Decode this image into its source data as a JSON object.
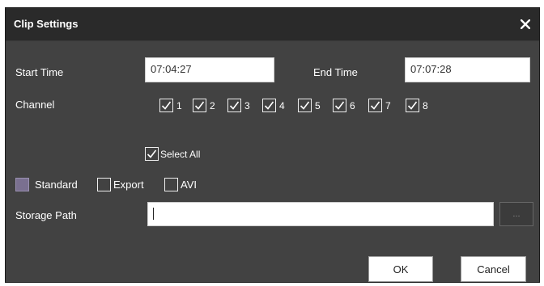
{
  "dialog": {
    "title": "Clip Settings",
    "close_glyph": "✕"
  },
  "time": {
    "start_label": "Start Time",
    "start_value": "07:04:27",
    "end_label": "End Time",
    "end_value": "07:07:28"
  },
  "channel": {
    "label": "Channel",
    "items": [
      "1",
      "2",
      "3",
      "4",
      "5",
      "6",
      "7",
      "8"
    ],
    "select_all_label": "Select All"
  },
  "format": {
    "options": [
      {
        "label": "Standard",
        "selected": true
      },
      {
        "label": "Export",
        "selected": false
      },
      {
        "label": "AVI",
        "selected": false
      }
    ]
  },
  "storage": {
    "label": "Storage Path",
    "value": "",
    "browse_label": "..."
  },
  "buttons": {
    "ok": "OK",
    "cancel": "Cancel"
  },
  "colors": {
    "dialog_bg": "#424242",
    "titlebar_bg": "#2a2a2a",
    "selected_square": "#7a7090"
  }
}
